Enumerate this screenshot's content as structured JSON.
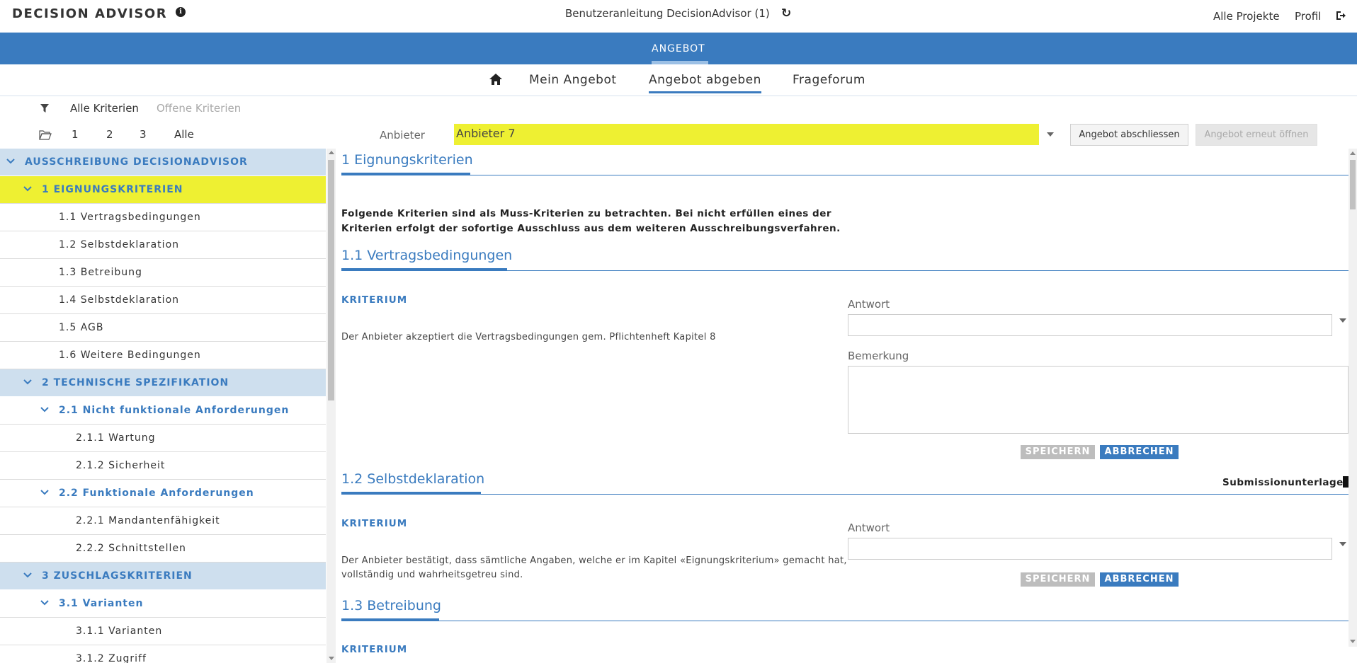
{
  "header": {
    "brand": "DECISION ADVISOR",
    "project_title": "Benutzeranleitung DecisionAdvisor (1)",
    "nav_all_projects": "Alle Projekte",
    "nav_profile": "Profil"
  },
  "blue_tab": {
    "label": "ANGEBOT"
  },
  "subnav": {
    "items": [
      "Mein Angebot",
      "Angebot abgeben",
      "Frageforum"
    ],
    "active": "Angebot abgeben"
  },
  "filter": {
    "all": "Alle Kriterien",
    "open": "Offene Kriterien",
    "levels": [
      "1",
      "2",
      "3",
      "Alle"
    ]
  },
  "anbieter": {
    "label": "Anbieter",
    "value": "Anbieter 7",
    "btn_close": "Angebot abschliessen",
    "btn_reopen": "Angebot erneut öffnen"
  },
  "tree": [
    {
      "label": "AUSSCHREIBUNG DECISIONADVISOR",
      "type": "sec"
    },
    {
      "label": "1 EIGNUNGSKRITERIEN",
      "type": "active"
    },
    {
      "label": "1.1 Vertragsbedingungen",
      "type": "leaf"
    },
    {
      "label": "1.2 Selbstdeklaration",
      "type": "leaf"
    },
    {
      "label": "1.3 Betreibung",
      "type": "leaf"
    },
    {
      "label": "1.4 Selbstdeklaration",
      "type": "leaf"
    },
    {
      "label": "1.5 AGB",
      "type": "leaf"
    },
    {
      "label": "1.6 Weitere Bedingungen",
      "type": "leaf"
    },
    {
      "label": "2 TECHNISCHE SPEZIFIKATION",
      "type": "sec"
    },
    {
      "label": "2.1 Nicht funktionale Anforderungen",
      "type": "group"
    },
    {
      "label": "2.1.1 Wartung",
      "type": "leaf"
    },
    {
      "label": "2.1.2 Sicherheit",
      "type": "leaf"
    },
    {
      "label": "2.2 Funktionale Anforderungen",
      "type": "group"
    },
    {
      "label": "2.2.1 Mandantenfähigkeit",
      "type": "leaf"
    },
    {
      "label": "2.2.2 Schnittstellen",
      "type": "leaf"
    },
    {
      "label": "3 ZUSCHLAGSKRITERIEN",
      "type": "sec"
    },
    {
      "label": "3.1 Varianten",
      "type": "group"
    },
    {
      "label": "3.1.1 Varianten",
      "type": "leaf"
    },
    {
      "label": "3.1.2 Zugriff",
      "type": "leaf"
    }
  ],
  "main": {
    "section1_title": "1 Eignungskriterien",
    "intro": "Folgende Kriterien sind als Muss-Kriterien zu betrachten. Bei nicht erfüllen eines der Kriterien erfolgt der sofortige Ausschluss aus dem weiteren Ausschreibungsverfahren.",
    "s11": {
      "title": "1.1 Vertragsbedingungen",
      "krit_label": "KRITERIUM",
      "text": "Der Anbieter akzeptiert die Vertragsbedingungen gem. Pflichtenheft Kapitel 8",
      "answer_label": "Antwort",
      "remark_label": "Bemerkung",
      "save": "SPEICHERN",
      "cancel": "ABBRECHEN"
    },
    "s12": {
      "title": "1.2 Selbstdeklaration",
      "submission": "Submissionunterlagen",
      "krit_label": "KRITERIUM",
      "text": "Der Anbieter bestätigt, dass sämtliche Angaben, welche er im Kapitel «Eignungskriterium» gemacht hat, vollständig und wahrheitsgetreu sind.",
      "answer_label": "Antwort",
      "save": "SPEICHERN",
      "cancel": "ABBRECHEN"
    },
    "s13": {
      "title": "1.3 Betreibung",
      "krit_label": "KRITERIUM"
    }
  }
}
